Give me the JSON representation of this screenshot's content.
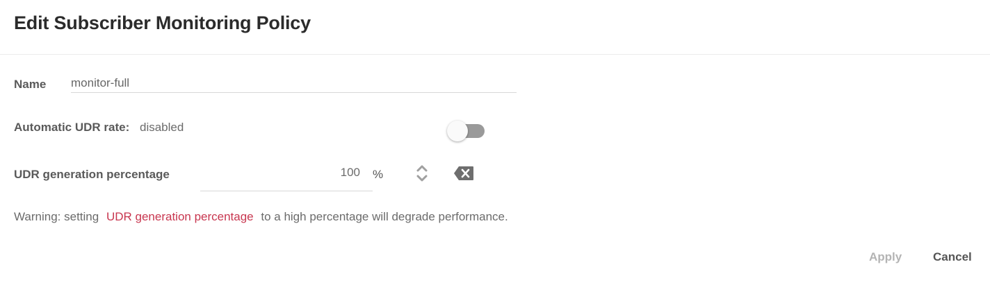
{
  "dialog": {
    "title": "Edit Subscriber Monitoring Policy"
  },
  "form": {
    "name": {
      "label": "Name",
      "value": "monitor-full"
    },
    "automatic_udr_rate": {
      "label": "Automatic UDR rate:",
      "status": "disabled",
      "toggle_on": false
    },
    "udr_generation_percentage": {
      "label": "UDR generation percentage",
      "value": "100",
      "unit": "%"
    },
    "warning": {
      "prefix": "Warning: setting",
      "highlight": "UDR generation percentage",
      "suffix": "to a high percentage will degrade performance."
    }
  },
  "actions": {
    "apply_label": "Apply",
    "cancel_label": "Cancel"
  },
  "colors": {
    "accent": "#c8364f",
    "toggle_off": "#9a9a9a",
    "disabled_text": "#b4b4b4"
  },
  "icons": {
    "stepper": "chevron-up-down-icon",
    "clear": "backspace-clear-icon"
  }
}
